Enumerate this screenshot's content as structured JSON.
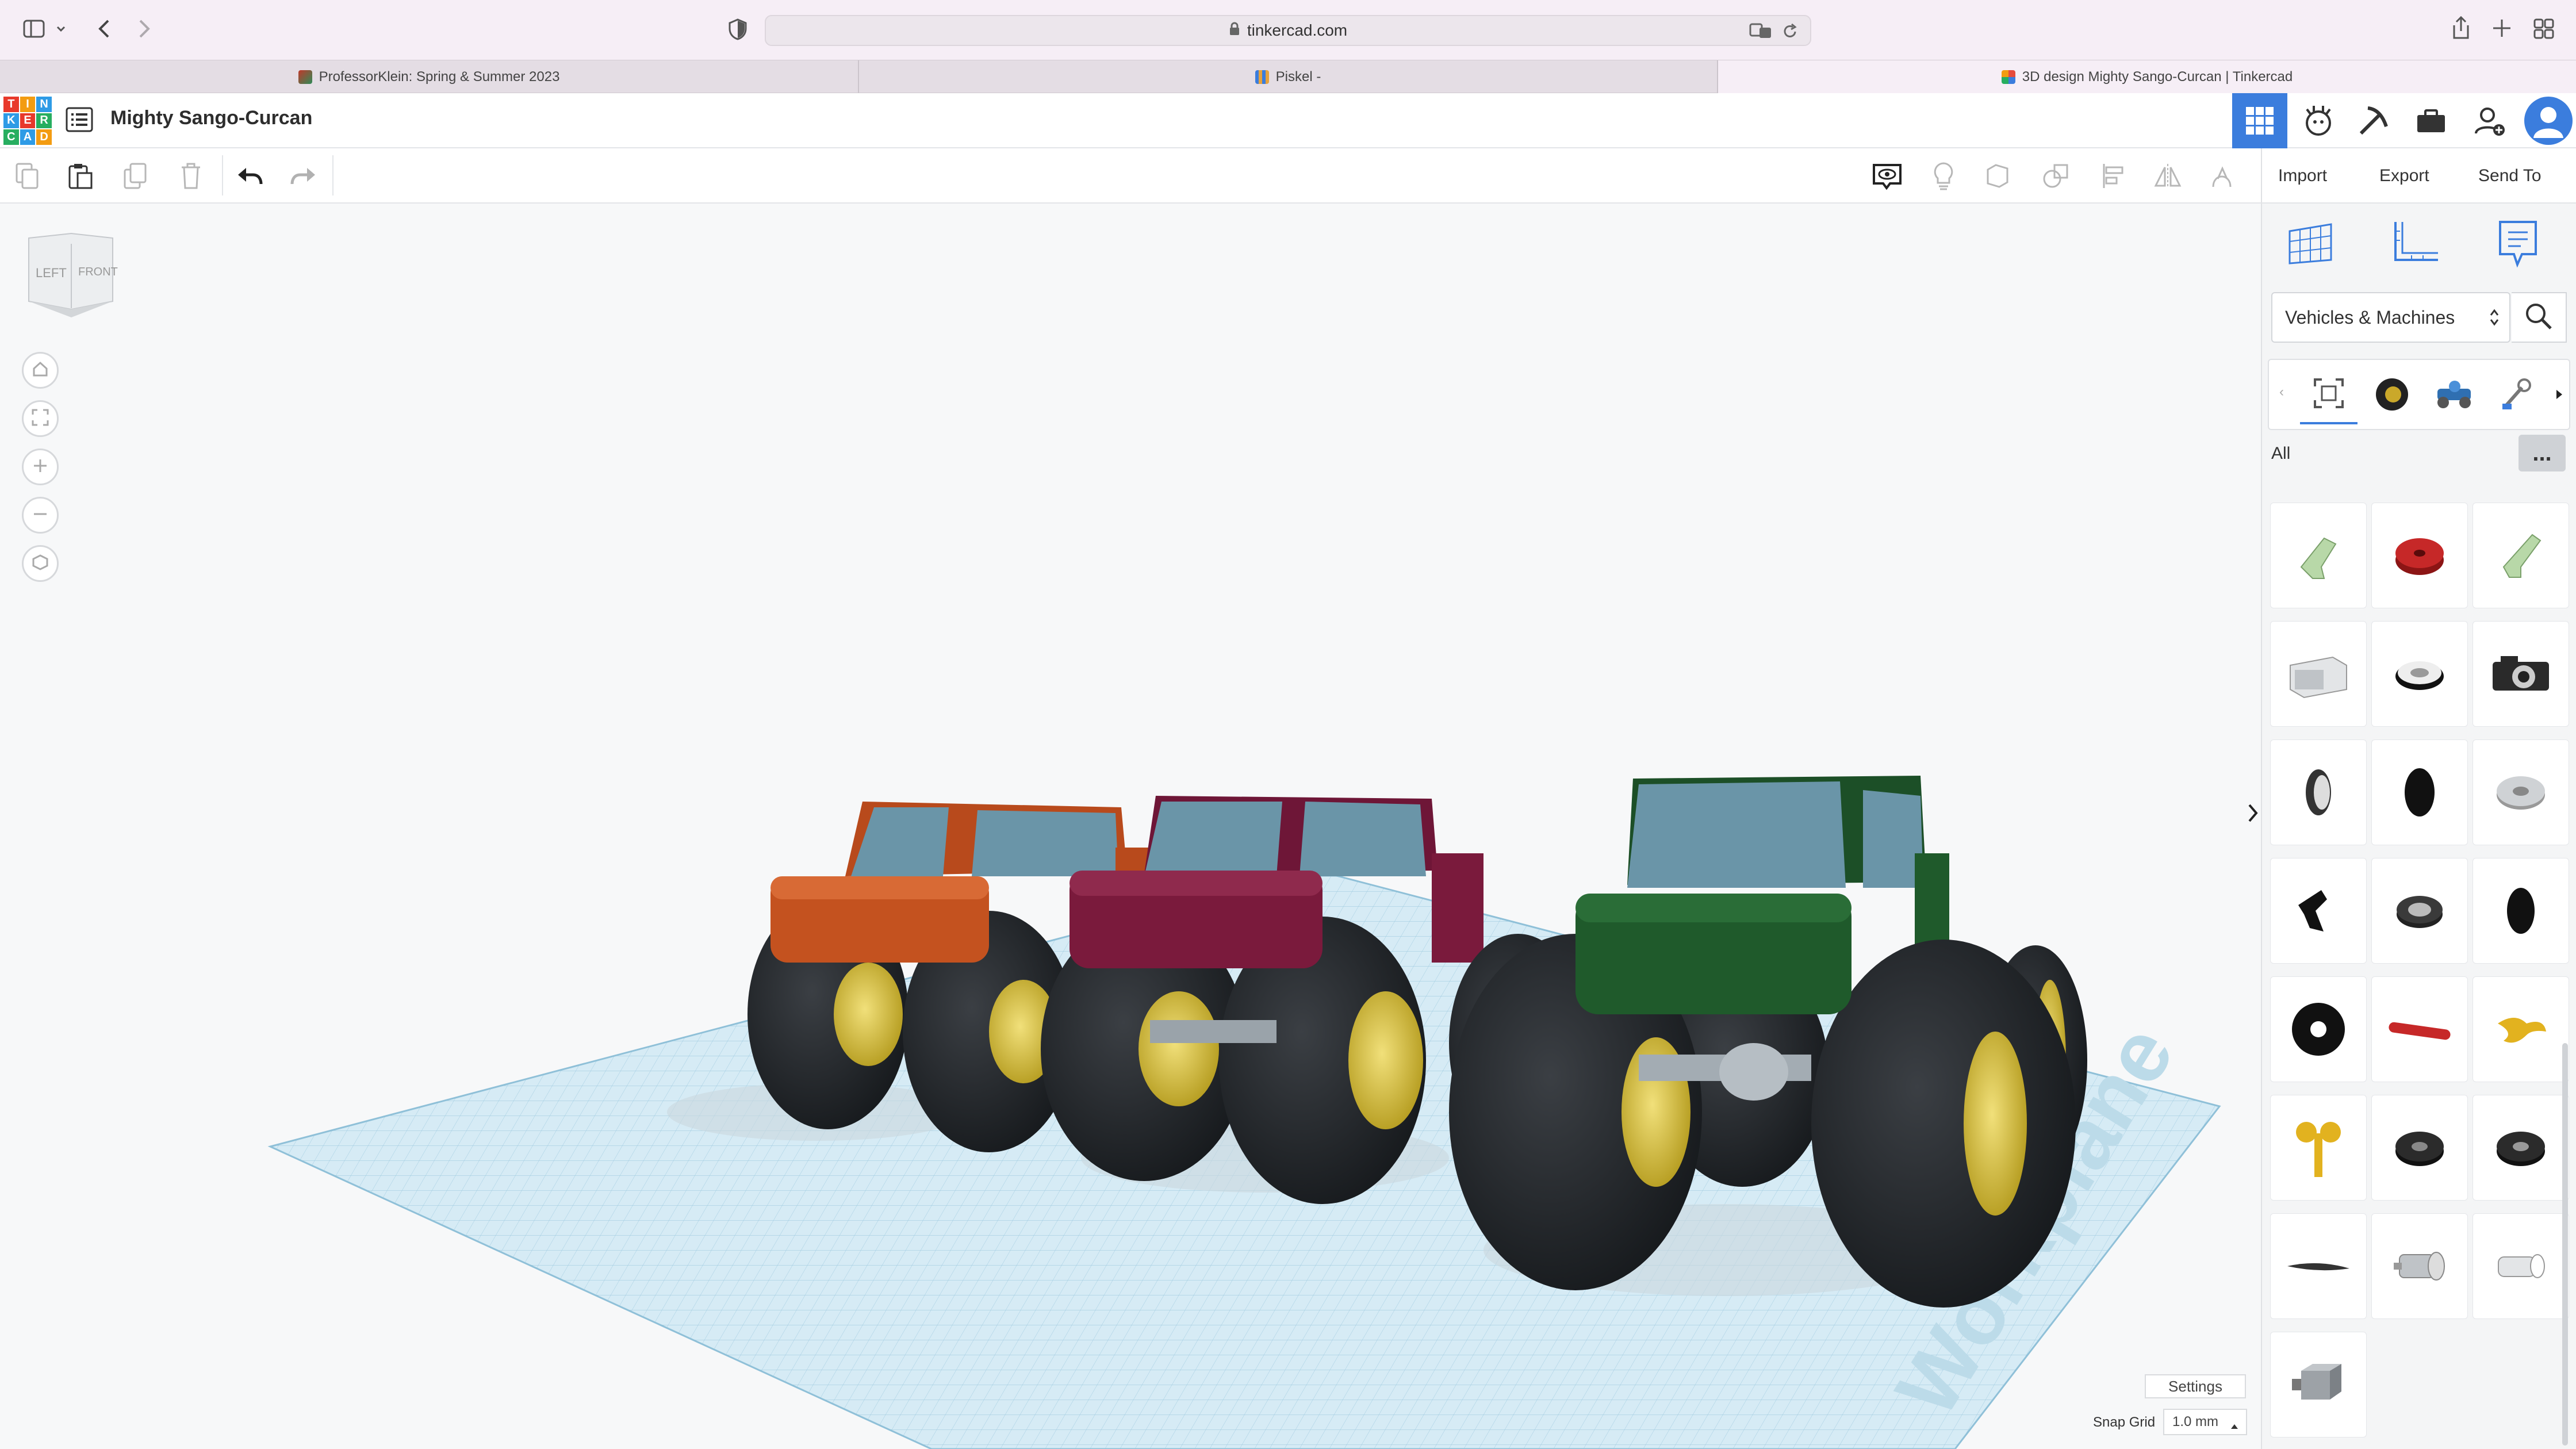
{
  "browser": {
    "url": "tinkercad.com",
    "tabs": [
      {
        "label": "ProfessorKlein: Spring & Summer 2023",
        "active": false
      },
      {
        "label": "Piskel -",
        "active": false
      },
      {
        "label": "3D design Mighty Sango-Curcan | Tinkercad",
        "active": true
      }
    ]
  },
  "header": {
    "logo_letters": [
      "T",
      "I",
      "N",
      "K",
      "E",
      "R",
      "C",
      "A",
      "D"
    ],
    "design_title": "Mighty Sango-Curcan",
    "right_icons": [
      "3d-design-icon",
      "codeblocks-icon",
      "minecraft-pickaxe-icon",
      "briefcase-icon",
      "add-user-icon",
      "avatar"
    ]
  },
  "toolbar": {
    "import_label": "Import",
    "export_label": "Export",
    "send_to_label": "Send To"
  },
  "viewcube": {
    "left_label": "LEFT",
    "front_label": "FRONT"
  },
  "workplane": {
    "watermark": "Workplane",
    "settings_label": "Settings",
    "snap_grid_label": "Snap Grid",
    "snap_grid_value": "1.0 mm"
  },
  "right_panel": {
    "category": "Vehicles & Machines",
    "filter_label": "All",
    "more_label": "...",
    "shapes": [
      "green-bracket",
      "red-tire",
      "green-bracket-2",
      "microwave",
      "steering-wheel",
      "camera",
      "thin-wheel",
      "black-tire",
      "gear-disc",
      "black-bracket",
      "wheel-hub",
      "tire-side",
      "flat-tire",
      "red-rod",
      "yellow-propeller",
      "yellow-key",
      "tire-dark",
      "tire-dark-2",
      "propeller-blade",
      "engine-cylinder",
      "engine-part",
      "motor-block"
    ]
  },
  "colors": {
    "orange_truck": "#c4521f",
    "maroon_truck": "#7a1a3c",
    "green_truck": "#1f5a2b",
    "accent_blue": "#3b7ddd",
    "wheel_yellow": "#d8c23a"
  }
}
